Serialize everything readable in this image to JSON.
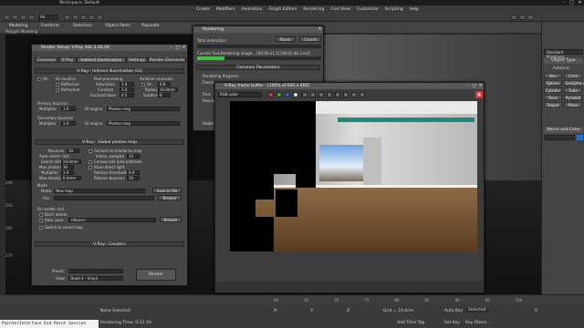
{
  "app": {
    "window_title": "Workspace: Default",
    "file_title": "",
    "search_placeholder": "",
    "menu": [
      "Create",
      "Modifiers",
      "Animation",
      "Graph Editors",
      "Rendering",
      "Civil View",
      "Customize",
      "Scripting",
      "Help"
    ],
    "ribbon": {
      "tabs": [
        "Modeling",
        "Freeform",
        "Selection",
        "Object Paint",
        "Populate"
      ],
      "subtitle": "Polygon Modeling",
      "toolbar_filter": "All"
    }
  },
  "command_panel": {
    "dropdown": "Standard Primitives",
    "section_object_type": "Object Type",
    "autogrid": "AutoGrid",
    "buttons": [
      "Box",
      "Cone",
      "Sphere",
      "GeoSphere",
      "Cylinder",
      "Tube",
      "Torus",
      "Pyramid",
      "Teapot",
      "Plane"
    ],
    "section_name_color": "Name and Color"
  },
  "viewport": {
    "ruler_labels": [
      "240",
      "250",
      "260",
      "270"
    ]
  },
  "render_setup": {
    "title": "Render Setup: V-Ray Adv 2.40.04",
    "tabs": [
      "Common",
      "V-Ray",
      "Indirect illumination",
      "Settings",
      "Render Elements"
    ],
    "gi_rollout": "V-Ray:: Indirect illumination (GI)",
    "on_label": "On",
    "gi_caustics": "GI caustics",
    "reflective": "Reflective",
    "refractive": "Refractive",
    "post_processing": "Post-processing",
    "saturation_label": "Saturation",
    "saturation": "1.0",
    "contrast_label": "Contrast",
    "contrast": "1.0",
    "contrast_base_label": "Contrast base",
    "contrast_base": "0.5",
    "ambient_occlusion": "Ambient occlusion",
    "ao_on": "On",
    "ao_value": "0.8",
    "radius_label": "Radius",
    "radius": "10.0mm",
    "subdivs_label": "Subdivs",
    "subdivs": "8",
    "primary_bounces": "Primary bounces",
    "multiplier_label": "Multiplier",
    "primary_multiplier": "1.0",
    "gi_engine_label": "GI engine",
    "primary_engine": "Photon map",
    "secondary_bounces": "Secondary bounces",
    "secondary_multiplier": "1.0",
    "secondary_engine": "Photon map",
    "photon_rollout": "V-Ray:: Global photon map",
    "bounces_label": "Bounces",
    "bounces": "10",
    "convert_irradiance": "Convert to irradiance map",
    "auto_search_dist": "Auto search dist",
    "interp_samples_label": "Interp. samples",
    "interp_samples": "10",
    "search_dist_label": "Search dist",
    "search_dist": "20.0mm",
    "convex_hull": "Convex hull area estimate",
    "max_photons_label": "Max photons",
    "max_photons": "30",
    "store_direct": "Store direct light",
    "multiplier2": "1.0",
    "retrace_threshold_label": "Retrace threshold",
    "retrace_threshold": "0.0",
    "max_density_label": "Max density",
    "max_density": "0.0mm",
    "retrace_bounces_label": "Retrace bounces",
    "retrace_bounces": "10",
    "mode_section": "Mode",
    "mode_label": "Mode:",
    "mode_value": "New map",
    "save_to_file": "Save to file",
    "file_label": "File:",
    "browse": "Browse",
    "on_render_end": "On render end",
    "dont_delete": "Don't delete",
    "auto_save": "Auto save:",
    "auto_save_value": "<None>",
    "browse2": "Browse",
    "switch_saved": "Switch to saved map",
    "caustics_rollout": "V-Ray:: Caustics",
    "preset_label": "Preset:",
    "view_label": "View:",
    "view_value": "Quad 4 - Vrayli",
    "render_button": "Render"
  },
  "rendering": {
    "title": "Rendering",
    "pause": "Pause",
    "cancel": "Cancel",
    "total_animation": "Total Animation:",
    "current_task_label": "Current Task:",
    "current_task": "Rendering image... [00:00:21.3] [00:01:46.3 est]",
    "progress": 0.22,
    "common_params": "Common Parameters",
    "rendering_progress": "Rendering Progress:",
    "frame": "Frame",
    "files": "Files",
    "resolution": "Resolutio",
    "hidden_line": "Hidde"
  },
  "vfb": {
    "title": "V-Ray frame buffer - [100% of 640 x 400]",
    "channel": "RGB color",
    "bottom_text": "",
    "swatch_colors": [
      "#d63a3a",
      "#3aa83a",
      "#3a5ed6",
      "#e0e0e0",
      "#111111"
    ]
  },
  "timeline": {
    "ticks": [
      "60",
      "65",
      "70",
      "75",
      "80",
      "85",
      "90",
      "95",
      "100"
    ]
  },
  "status": {
    "selected": "None Selected",
    "rendering_time": "Rendering Time: 0:12:16",
    "x_coord": "X:",
    "y_coord": "Y:",
    "z_coord": "Z:",
    "grid": "Grid = 10,0cm",
    "auto_key": "Auto Key",
    "selected_dd": "Selected",
    "set_key": "Set Key",
    "key_filters": "Key Filters...",
    "add_time_tag": "Add Time Tag",
    "frame_value": "0",
    "cmd_text": "PainterInterface End Paint Session"
  }
}
